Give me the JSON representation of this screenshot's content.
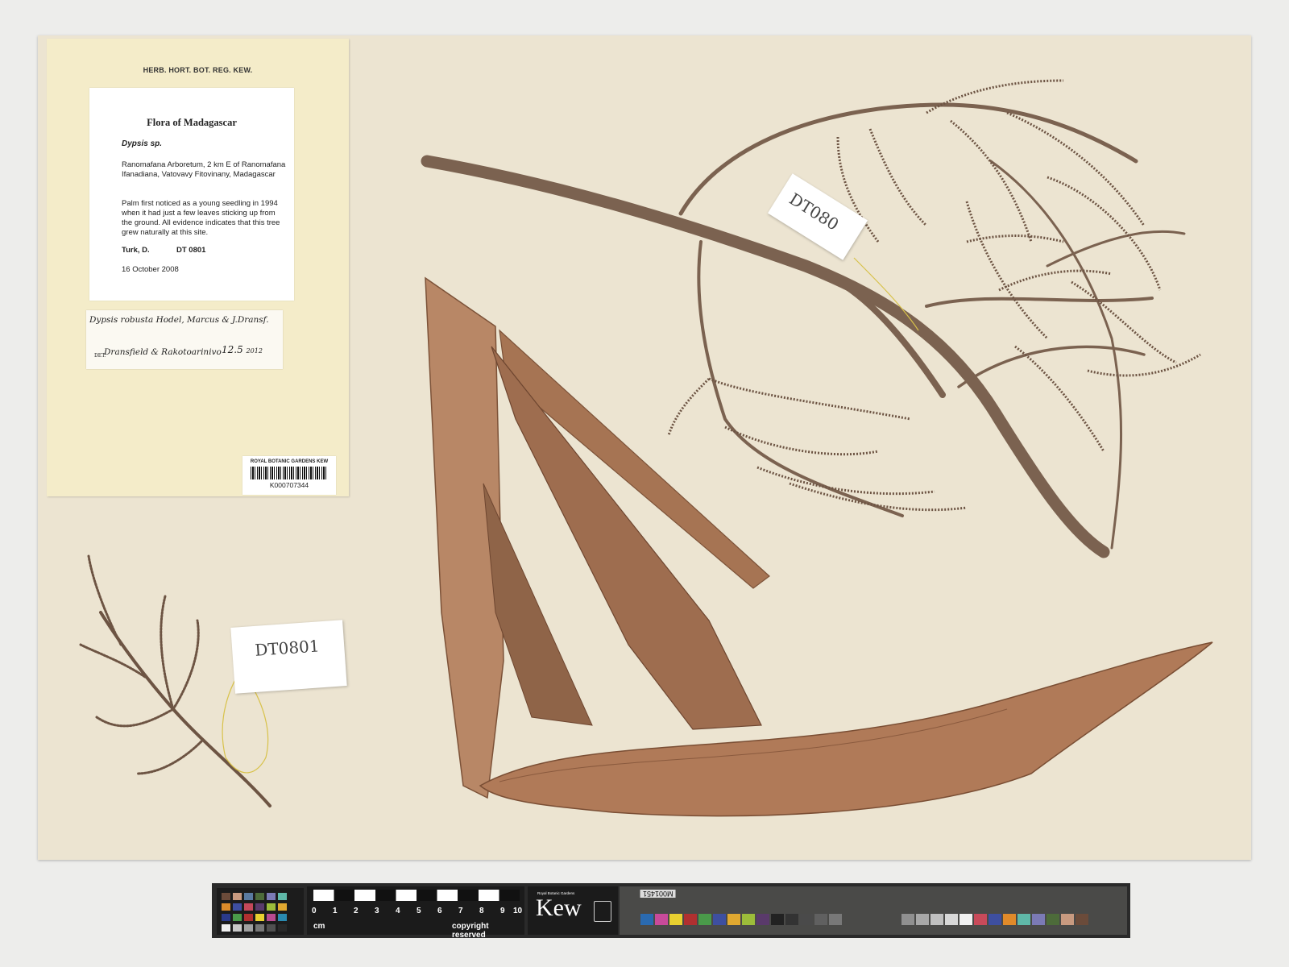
{
  "herbarium_header": "HERB. HORT. BOT. REG. KEW.",
  "label": {
    "title": "Flora of Madagascar",
    "species": "Dypsis sp.",
    "locality": "Ranomafana Arboretum, 2 km E of Ranomafana Ifanadiana, Vatovavy Fitovinany, Madagascar",
    "notes": "Palm first noticed as a young seedling in 1994 when it had just a few leaves sticking up from the ground. All evidence indicates that this tree grew naturally at this site.",
    "collector": "Turk, D.",
    "collection_number": "DT  0801",
    "date": "16 October 2008"
  },
  "determination": {
    "name": "Dypsis robusta Hodel, Marcus & J.Dransf.",
    "prefix": "DET.",
    "determiner": "Dransfield & Rakotoarinivo",
    "date": "12.5",
    "year": "2012"
  },
  "barcode": {
    "institution": "ROYAL BOTANIC GARDENS KEW",
    "code": "K000707344"
  },
  "tags": {
    "top": "DT080",
    "bottom": "DT0801"
  },
  "scalebar": {
    "numbers": [
      "0",
      "1",
      "2",
      "3",
      "4",
      "5",
      "6",
      "7",
      "8",
      "9",
      "10"
    ],
    "unit": "cm",
    "copyright": "copyright reserved",
    "logo_text": "Kew",
    "logo_small": "Royal Botanic Gardens",
    "target_id": "M001451"
  },
  "colors": {
    "sheet": "#ece4d1",
    "label_paper": "#f4ecc9",
    "stem": "#7b6250",
    "leaf": "#b07a58"
  }
}
